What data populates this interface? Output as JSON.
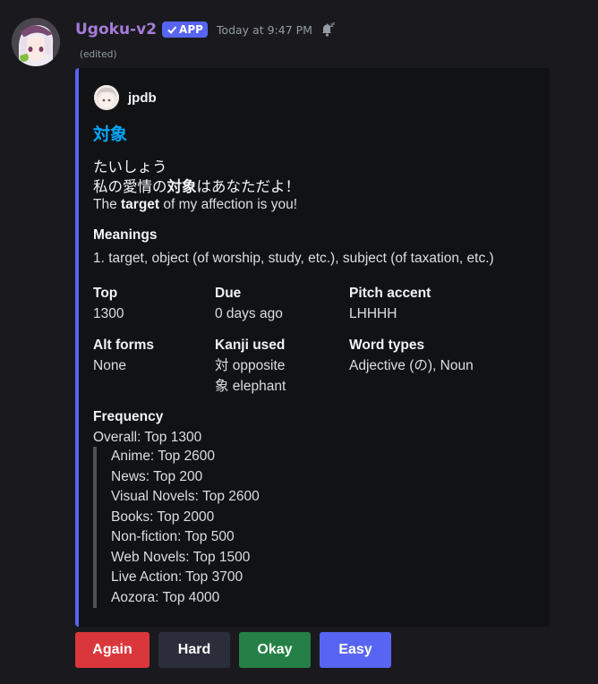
{
  "message": {
    "username": "Ugoku-v2",
    "badge": "APP",
    "timestamp": "Today at 9:47 PM",
    "edited": "(edited)"
  },
  "embed": {
    "accent_color": "#5865f2",
    "author": "jpdb",
    "title": "対象",
    "reading": "たいしょう",
    "sentence_jp": {
      "pre": "私の愛情の",
      "bold": "対象",
      "post": "はあなただよ！"
    },
    "sentence_en": {
      "pre": "The ",
      "bold": "target",
      "post": " of my affection is you!"
    },
    "meanings_label": "Meanings",
    "meanings_value": "1. target, object (of worship, study, etc.), subject (of taxation, etc.)",
    "fields": {
      "top": {
        "name": "Top",
        "value": "1300"
      },
      "due": {
        "name": "Due",
        "value": "0 days ago"
      },
      "pitch": {
        "name": "Pitch accent",
        "value": "LHHHH"
      },
      "alt_forms": {
        "name": "Alt forms",
        "value": "None"
      },
      "kanji_used": {
        "name": "Kanji used",
        "lines": [
          "対 opposite",
          "象 elephant"
        ]
      },
      "word_types": {
        "name": "Word types",
        "value": "Adjective (の), Noun"
      }
    },
    "frequency": {
      "label": "Frequency",
      "overall": "Overall: Top 1300",
      "items": [
        "Anime: Top 2600",
        "News: Top 200",
        "Visual Novels: Top 2600",
        "Books: Top 2000",
        "Non-fiction: Top 500",
        "Web Novels: Top 1500",
        "Live Action: Top 3700",
        "Aozora: Top 4000"
      ]
    }
  },
  "buttons": {
    "again": {
      "label": "Again",
      "color": "#da373c"
    },
    "hard": {
      "label": "Hard",
      "color": "#2b2d3a"
    },
    "okay": {
      "label": "Okay",
      "color": "#248046"
    },
    "easy": {
      "label": "Easy",
      "color": "#5865f2"
    }
  }
}
